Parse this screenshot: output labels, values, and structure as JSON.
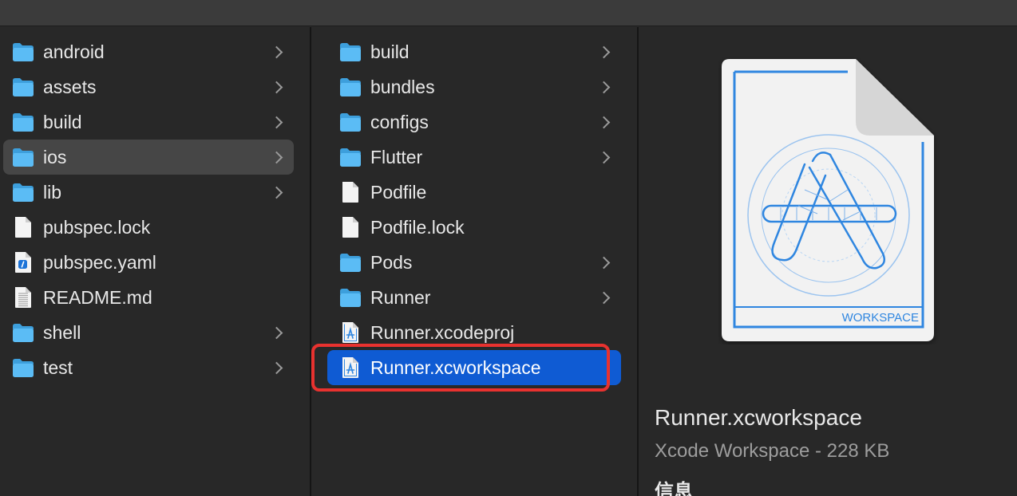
{
  "colors": {
    "background": "#282828",
    "selection": "#0f5bd3",
    "hover_row": "#464646",
    "highlight_box": "#e8322f",
    "folder": "#5bbcf5",
    "xcode_blue": "#2f86e0"
  },
  "column1": {
    "items": [
      {
        "label": "android",
        "icon": "folder-icon",
        "chevron": true,
        "state": ""
      },
      {
        "label": "assets",
        "icon": "folder-icon",
        "chevron": true,
        "state": ""
      },
      {
        "label": "build",
        "icon": "folder-icon",
        "chevron": true,
        "state": ""
      },
      {
        "label": "ios",
        "icon": "folder-icon",
        "chevron": true,
        "state": "highlighted"
      },
      {
        "label": "lib",
        "icon": "folder-icon",
        "chevron": true,
        "state": ""
      },
      {
        "label": "pubspec.lock",
        "icon": "document-icon",
        "chevron": false,
        "state": ""
      },
      {
        "label": "pubspec.yaml",
        "icon": "yaml-file-icon",
        "chevron": false,
        "state": ""
      },
      {
        "label": "README.md",
        "icon": "text-file-icon",
        "chevron": false,
        "state": ""
      },
      {
        "label": "shell",
        "icon": "folder-icon",
        "chevron": true,
        "state": ""
      },
      {
        "label": "test",
        "icon": "folder-icon",
        "chevron": true,
        "state": ""
      }
    ]
  },
  "column2": {
    "items": [
      {
        "label": "build",
        "icon": "folder-icon",
        "chevron": true,
        "state": ""
      },
      {
        "label": "bundles",
        "icon": "folder-icon",
        "chevron": true,
        "state": ""
      },
      {
        "label": "configs",
        "icon": "folder-icon",
        "chevron": true,
        "state": ""
      },
      {
        "label": "Flutter",
        "icon": "folder-icon",
        "chevron": true,
        "state": ""
      },
      {
        "label": "Podfile",
        "icon": "document-icon",
        "chevron": false,
        "state": ""
      },
      {
        "label": "Podfile.lock",
        "icon": "document-icon",
        "chevron": false,
        "state": ""
      },
      {
        "label": "Pods",
        "icon": "folder-icon",
        "chevron": true,
        "state": ""
      },
      {
        "label": "Runner",
        "icon": "folder-icon",
        "chevron": true,
        "state": ""
      },
      {
        "label": "Runner.xcodeproj",
        "icon": "xcode-file-icon",
        "chevron": false,
        "state": ""
      },
      {
        "label": "Runner.xcworkspace",
        "icon": "xcode-file-icon",
        "chevron": false,
        "state": "selected"
      }
    ]
  },
  "preview": {
    "badge": "WORKSPACE",
    "title": "Runner.xcworkspace",
    "subtitle": "Xcode Workspace - 228 KB",
    "info_heading": "信息"
  }
}
